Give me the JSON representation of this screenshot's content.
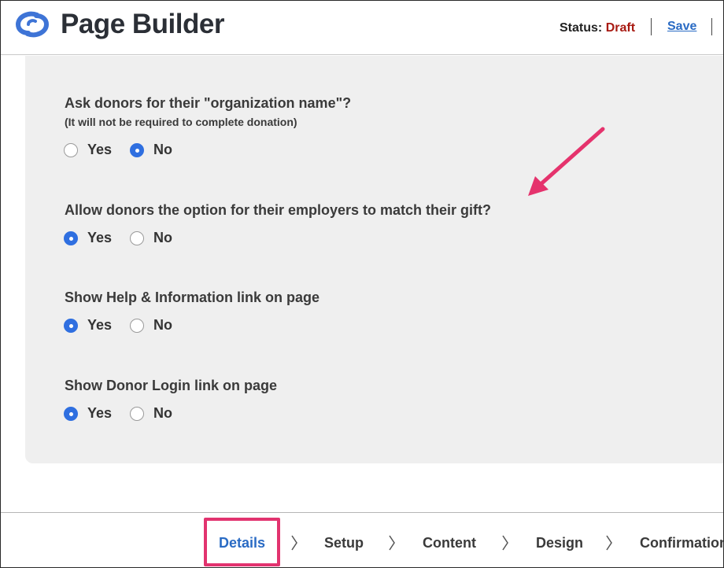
{
  "header": {
    "app_title": "Page Builder",
    "status_label": "Status:",
    "status_value": "Draft",
    "save_label": "Save",
    "logo_icon": "swirl-logo-icon",
    "colors": {
      "accent": "#2a6bc4",
      "status_draft": "#a81a12",
      "logo": "#3e74d6"
    }
  },
  "questions": [
    {
      "label": "Ask donors for their \"organization name\"?",
      "note": "(It will not be required to complete donation)",
      "options": [
        "Yes",
        "No"
      ],
      "selected": "No"
    },
    {
      "label": "Allow donors the option for their employers to match their gift?",
      "options": [
        "Yes",
        "No"
      ],
      "selected": "Yes"
    },
    {
      "label": "Show Help & Information link on page",
      "options": [
        "Yes",
        "No"
      ],
      "selected": "Yes"
    },
    {
      "label": "Show Donor Login link on page",
      "options": [
        "Yes",
        "No"
      ],
      "selected": "Yes"
    }
  ],
  "steps": [
    {
      "label": "Details",
      "active": true
    },
    {
      "label": "Setup",
      "active": false
    },
    {
      "label": "Content",
      "active": false
    },
    {
      "label": "Design",
      "active": false
    },
    {
      "label": "Confirmation",
      "active": false
    }
  ],
  "annotation": {
    "arrow_color": "#e5336d",
    "highlight_color": "#e2336f"
  }
}
